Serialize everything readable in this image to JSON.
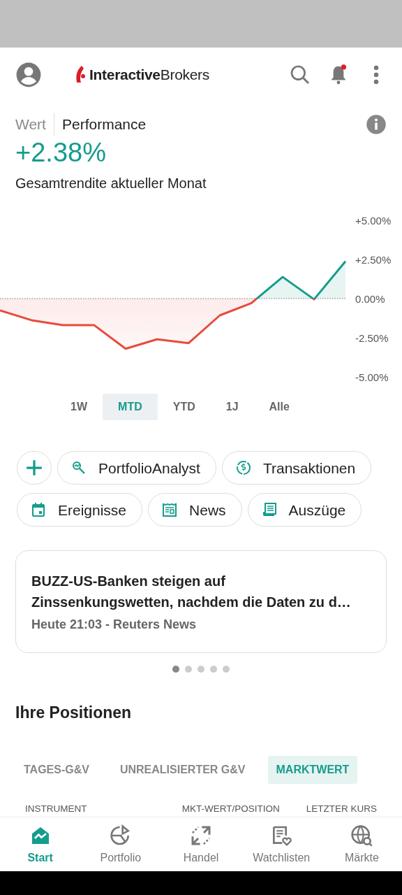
{
  "header": {
    "logo": "**Interactive**Brokers",
    "notification_dot": true
  },
  "view_tabs": [
    {
      "label": "Wert",
      "selected": false
    },
    {
      "label": "Performance",
      "selected": true
    }
  ],
  "return_value": "+2.38%",
  "return_caption": "Gesamtrendite aktueller Monat",
  "chart_data": {
    "type": "area",
    "ylim": [
      -5,
      5
    ],
    "yticks": [
      {
        "value": 5,
        "label": "+5.00%"
      },
      {
        "value": 2.5,
        "label": "+2.50%"
      },
      {
        "value": 0,
        "label": "0.00%"
      },
      {
        "value": -2.5,
        "label": "-2.50%"
      },
      {
        "value": -5,
        "label": "-5.00%"
      }
    ],
    "series": [
      {
        "color": "#149c8c",
        "values": [
          -0.76,
          -1.38,
          -1.7,
          -1.7,
          -3.2,
          -2.6,
          -2.85,
          -1.07,
          -0.3,
          1.38,
          -0.05,
          2.38
        ]
      }
    ]
  },
  "ranges": [
    {
      "label": "1W",
      "selected": false
    },
    {
      "label": "MTD",
      "selected": true
    },
    {
      "label": "YTD",
      "selected": false
    },
    {
      "label": "1J",
      "selected": false
    },
    {
      "label": "Alle",
      "selected": false
    }
  ],
  "shortcuts": [
    [
      "PortfolioAnalyst",
      "Transaktionen"
    ],
    [
      "Ereignisse",
      "News",
      "Auszüge"
    ]
  ],
  "news": {
    "headline": "BUZZ-US-Banken steigen auf Zinssenkungswetten, nachdem die Daten zu d…",
    "meta": "Heute 21:03 - Reuters News"
  },
  "pager": [
    {
      "selected": true
    },
    {
      "selected": false
    },
    {
      "selected": false
    },
    {
      "selected": false
    },
    {
      "selected": false
    }
  ],
  "positions": {
    "title": "Ihre Positionen",
    "tabs": [
      {
        "label": "TAGES-G&V",
        "selected": false
      },
      {
        "label": "UNREALISIERTER G&V",
        "selected": false
      },
      {
        "label": "MARKTWERT",
        "selected": true
      }
    ],
    "columns": [
      "INSTRUMENT",
      "MKT-WERT/POSITION",
      "LETZTER KURS"
    ]
  },
  "bottom_nav": [
    {
      "label": "Start",
      "selected": true
    },
    {
      "label": "Portfolio",
      "selected": false
    },
    {
      "label": "Handel",
      "selected": false
    },
    {
      "label": "Watchlisten",
      "selected": false
    },
    {
      "label": "Märkte",
      "selected": false
    }
  ]
}
